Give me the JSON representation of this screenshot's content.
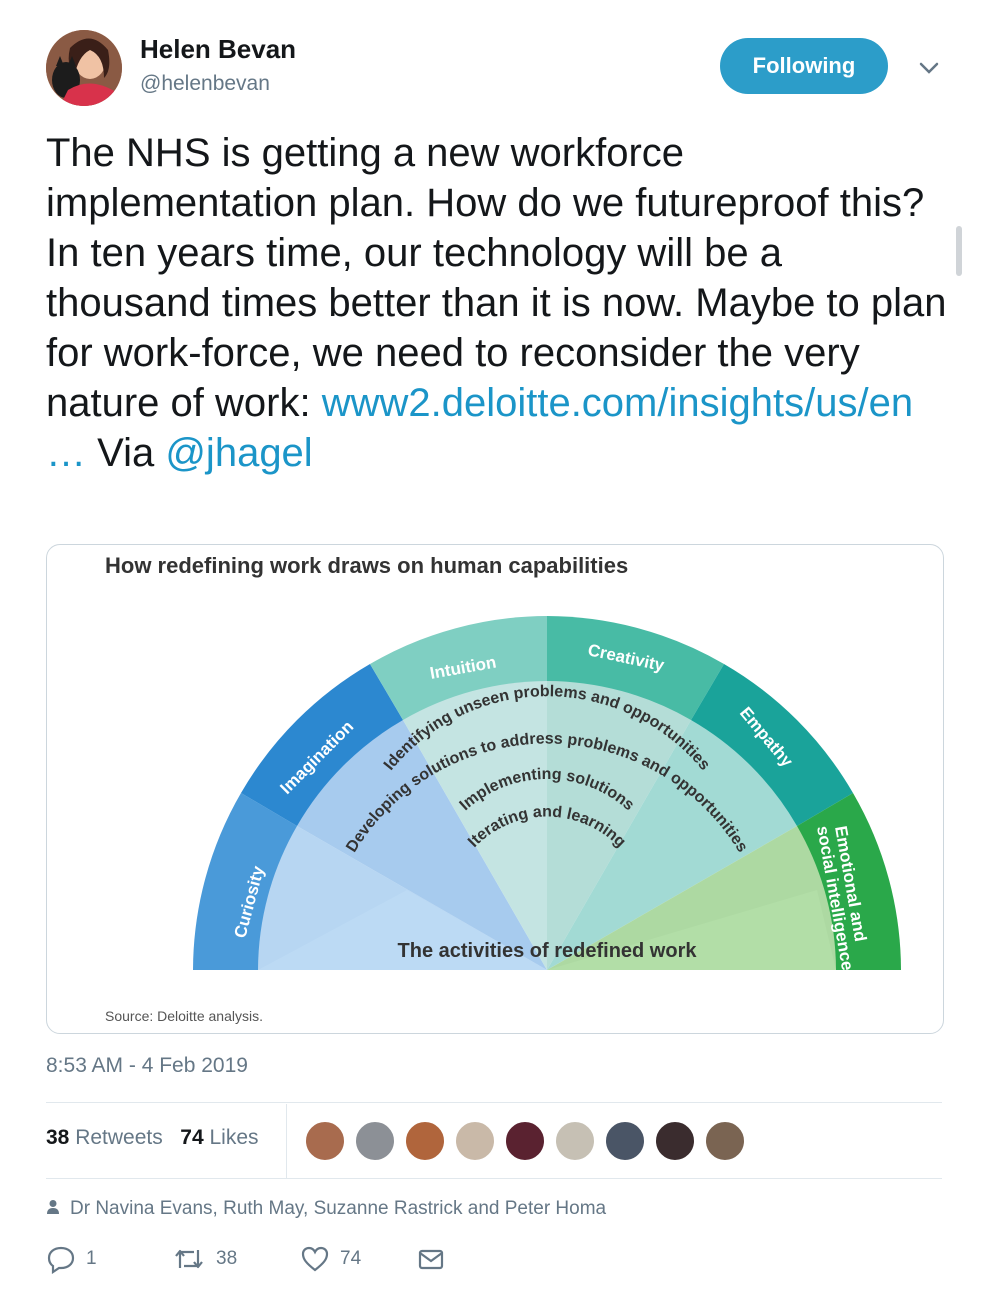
{
  "user": {
    "name": "Helen Bevan",
    "handle": "@helenbevan"
  },
  "follow_button": "Following",
  "tweet": {
    "text_1": "The NHS is getting a new workforce implementation plan. How do we futureproof this? In ten years time, our technology will be a thousand times better than it is now. Maybe to plan for work-force, we need to reconsider the very nature of work: ",
    "link": "www2.deloitte.com/insights/us/en",
    "ellipsis": " …",
    "text_2": " Via ",
    "mention": "@jhagel"
  },
  "card": {
    "title": "How redefining work draws on human capabilities",
    "capabilities": [
      "Curiosity",
      "Imagination",
      "Intuition",
      "Creativity",
      "Empathy",
      "Emotional and",
      "social intelligence"
    ],
    "activities": [
      "Identifying unseen problems and opportunities",
      "Developing solutions to address problems and opportunities",
      "Implementing solutions",
      "Iterating and learning"
    ],
    "center_label": "The activities of redefined work",
    "source": "Source: Deloitte analysis."
  },
  "timestamp": "8:53 AM - 4 Feb 2019",
  "stats": {
    "retweets_count": "38",
    "retweets_label": "Retweets",
    "likes_count": "74",
    "likes_label": "Likes"
  },
  "liked_by": "Dr Navina Evans, Ruth May, Suzanne Rastrick and Peter Homa",
  "actions": {
    "replies": "1",
    "retweets": "38",
    "likes": "74"
  },
  "colors": {
    "accent": "#2c9dc9",
    "link": "#1b95c8",
    "muted": "#657786"
  }
}
